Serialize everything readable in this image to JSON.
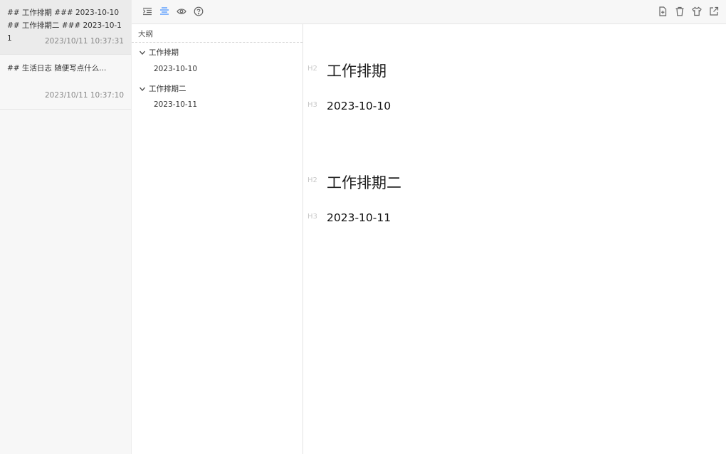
{
  "notes": [
    {
      "preview": "## 工作排期 ### 2023-10-10 ## 工作排期二 ### 2023-10-11",
      "time": "2023/10/11 10:37:31"
    },
    {
      "preview": "## 生活日志 随便写点什么...",
      "time": "2023/10/11 10:37:10"
    }
  ],
  "toolbar": {
    "left_icons": [
      "indent-icon",
      "outline-icon",
      "preview-eye-icon",
      "help-icon"
    ],
    "right_icons": [
      "new-file-icon",
      "trash-icon",
      "theme-shirt-icon",
      "export-icon"
    ],
    "accent": "#3b8bff"
  },
  "outline": {
    "title": "大纲",
    "items": [
      {
        "label": "工作排期",
        "children": [
          "2023-10-10"
        ]
      },
      {
        "label": "工作排期二",
        "children": [
          "2023-10-11"
        ]
      }
    ]
  },
  "editor": {
    "blocks": [
      {
        "mark": "H2",
        "text": "工作排期"
      },
      {
        "mark": "H3",
        "text": "2023-10-10"
      },
      {
        "mark": "H2",
        "text": "工作排期二"
      },
      {
        "mark": "H3",
        "text": "2023-10-11"
      }
    ]
  }
}
